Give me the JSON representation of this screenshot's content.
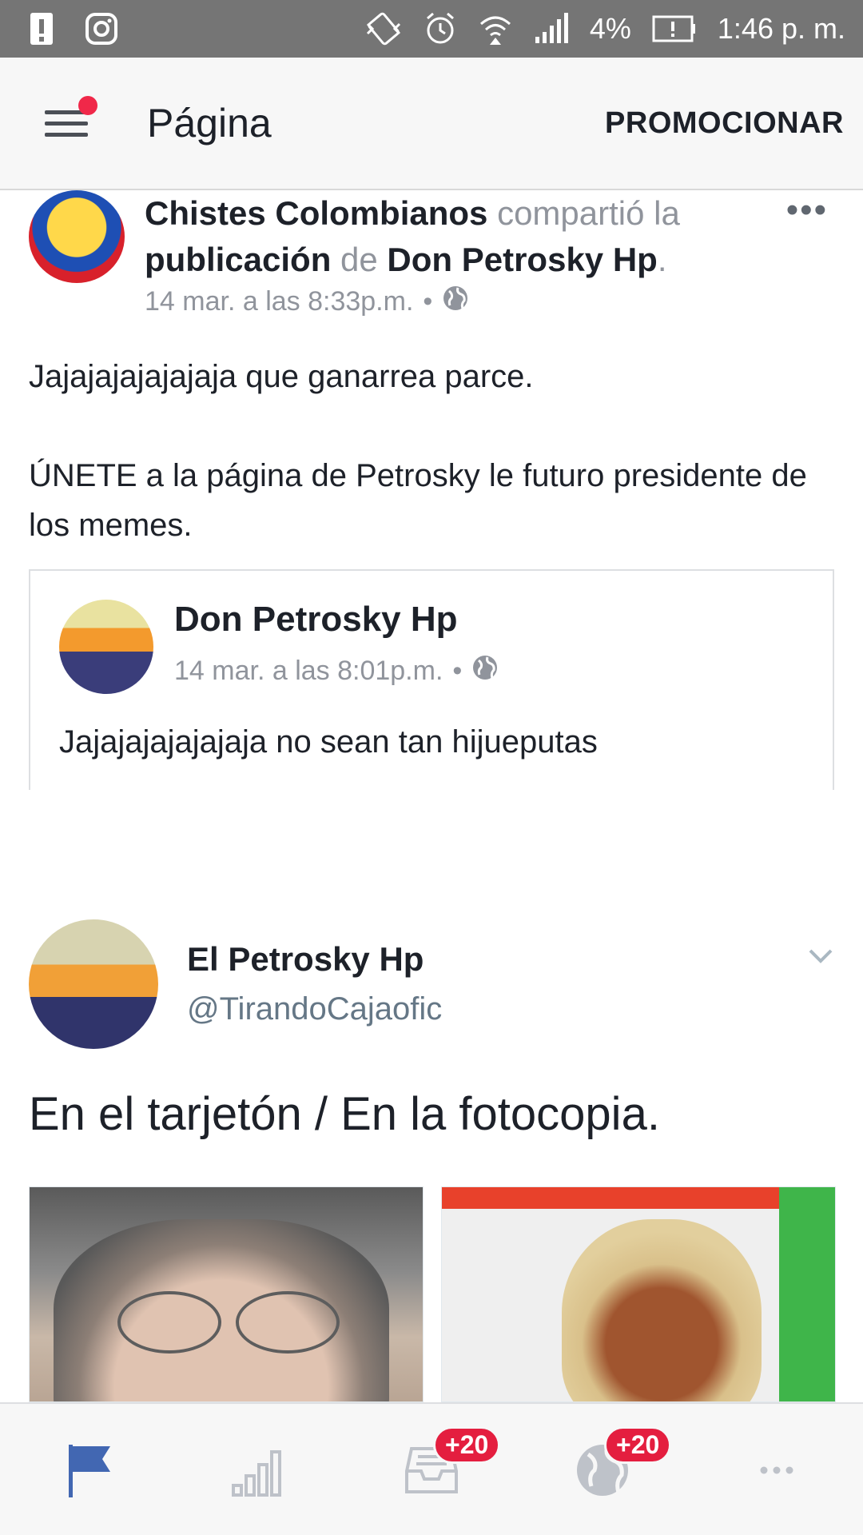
{
  "status_bar": {
    "battery_percent": "4%",
    "time": "1:46 p. m."
  },
  "app_bar": {
    "title": "Página",
    "promote_label": "PROMOCIONAR"
  },
  "post1": {
    "page_name": "Chistes Colombianos",
    "shared_verb": "compartió la",
    "publication_word": "publicación",
    "of_word": "de",
    "original_author": "Don Petrosky Hp",
    "period": ".",
    "timestamp": "14 mar. a las 8:33p.m.",
    "separator": "•",
    "text_line1": "Jajajajajajajaja que ganarrea parce.",
    "text_line2": "ÚNETE a la página de Petrosky le futuro presidente de los memes.",
    "shared": {
      "author": "Don Petrosky Hp",
      "timestamp": "14 mar. a las 8:01p.m.",
      "separator": "•",
      "text": "Jajajajajajajaja no sean tan hijueputas"
    }
  },
  "post2": {
    "name": "El Petrosky Hp",
    "handle": "@TirandoCajaofic",
    "text": "En el tarjetón / En la fotocopia."
  },
  "bottom_nav": {
    "items": [
      {
        "icon": "flag-icon",
        "active": true
      },
      {
        "icon": "bar-chart-icon"
      },
      {
        "icon": "inbox-icon",
        "badge": "+20"
      },
      {
        "icon": "globe-icon",
        "badge": "+20"
      },
      {
        "icon": "more-icon"
      }
    ]
  },
  "colors": {
    "accent": "#4267b2",
    "badge": "#e41e3f",
    "notification_dot": "#f02849"
  }
}
